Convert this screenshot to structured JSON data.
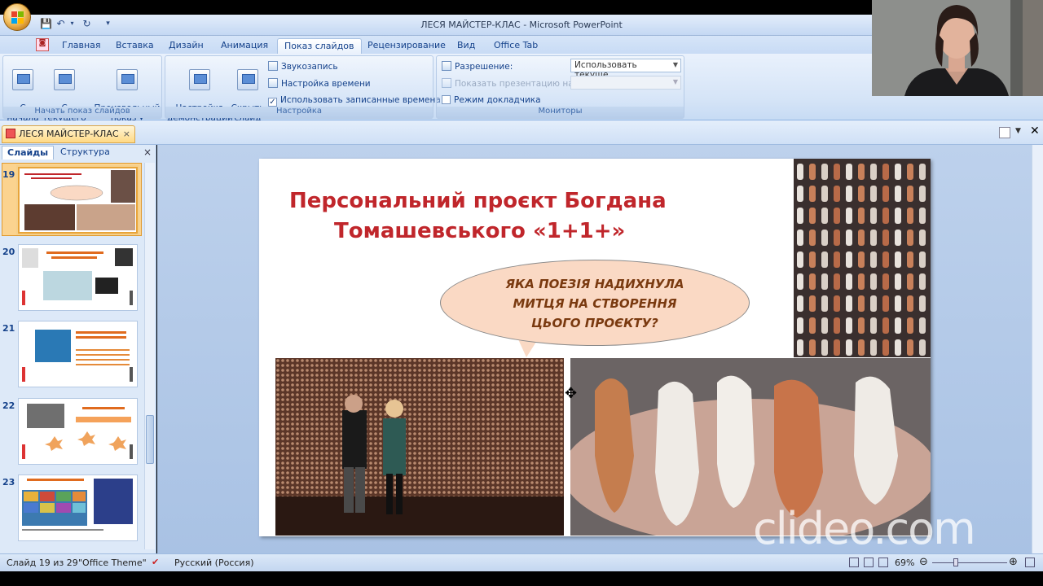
{
  "window": {
    "title": "ЛЕСЯ МАЙСТЕР-КЛАС - Microsoft PowerPoint"
  },
  "ribbon_tabs": [
    {
      "label": "Главная"
    },
    {
      "label": "Вставка"
    },
    {
      "label": "Дизайн"
    },
    {
      "label": "Анимация"
    },
    {
      "label": "Показ слайдов"
    },
    {
      "label": "Рецензирование"
    },
    {
      "label": "Вид"
    },
    {
      "label": "Office Tab"
    }
  ],
  "ribbon": {
    "group_start": {
      "label": "Начать показ слайдов",
      "from_start": "С\nначала",
      "from_current": "С текущего\nслайда",
      "custom_show": "Произвольный\nпоказ ▾"
    },
    "group_setup": {
      "label": "Настройка",
      "setup_show": "Настройка\nдемонстрации",
      "hide_slide": "Скрыть\nслайд",
      "record_narration": "Звукозапись",
      "rehearse_timings": "Настройка времени",
      "use_timings": "Использовать записанные времена",
      "use_timings_checked": "✓"
    },
    "group_monitors": {
      "label": "Мониторы",
      "resolution_label": "Разрешение:",
      "resolution_value": "Использовать текуще...",
      "show_on_label": "Показать презентацию на:",
      "presenter_view": "Режим докладчика"
    }
  },
  "document_tab": {
    "name": "ЛЕСЯ МАЙСТЕР-КЛАС",
    "close": "×"
  },
  "slides_pane": {
    "tab_slides": "Слайды",
    "tab_outline": "Структура",
    "close": "×",
    "thumbnails": [
      {
        "number": "19"
      },
      {
        "number": "20"
      },
      {
        "number": "21"
      },
      {
        "number": "22"
      },
      {
        "number": "23"
      }
    ]
  },
  "slide": {
    "title_line1": "Персональний проєкт Богдана",
    "title_line2": "Томашевського «1+1+»",
    "bubble_line1": "ЯКА ПОЕЗІЯ НАДИХНУЛА",
    "bubble_line2": "МИТЦЯ НА СТВОРЕННЯ",
    "bubble_line3": "ЦЬОГО ПРОЄКТУ?"
  },
  "status_bar": {
    "slide_counter": "Слайд 19 из 29",
    "theme": "\"Office Theme\"",
    "language": "Русский (Россия)",
    "zoom": "69%"
  },
  "watermark": "clideo.com",
  "colors": {
    "title_red": "#c0262b",
    "bubble_fill": "#fad9c4",
    "selected_thumb": "#fbd38f"
  }
}
